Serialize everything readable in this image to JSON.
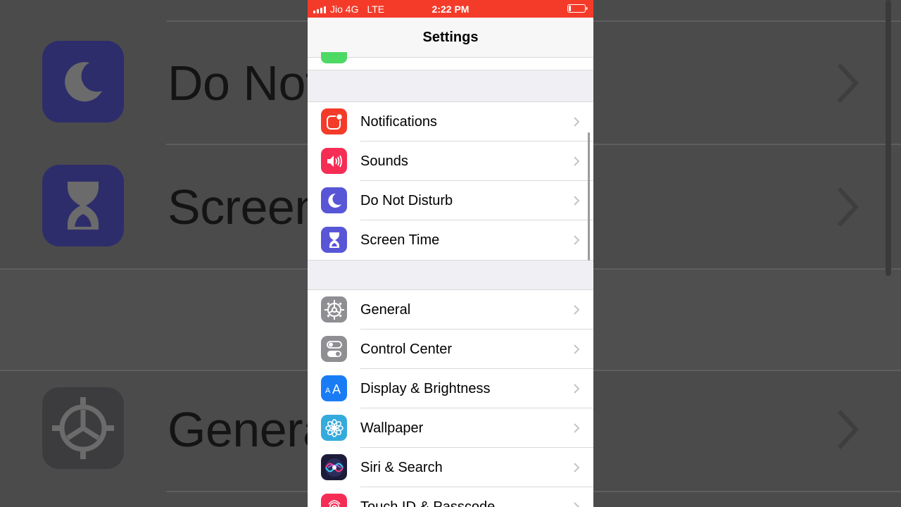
{
  "status_bar": {
    "carrier": "Jio 4G",
    "network": "LTE",
    "time": "2:22 PM",
    "background_color": "#f43b2a"
  },
  "nav": {
    "title": "Settings"
  },
  "groups": [
    {
      "items": [
        {
          "label": "Notifications",
          "icon": "notifications-icon",
          "color": "#f43b2a"
        },
        {
          "label": "Sounds",
          "icon": "speaker-icon",
          "color": "#f52d55"
        },
        {
          "label": "Do Not Disturb",
          "icon": "moon-icon",
          "color": "#5856d6"
        },
        {
          "label": "Screen Time",
          "icon": "hourglass-icon",
          "color": "#5856d6"
        }
      ]
    },
    {
      "items": [
        {
          "label": "General",
          "icon": "gear-icon",
          "color": "#8e8e93"
        },
        {
          "label": "Control Center",
          "icon": "toggles-icon",
          "color": "#8e8e93"
        },
        {
          "label": "Display & Brightness",
          "icon": "text-size-icon",
          "color": "#1a7cf5"
        },
        {
          "label": "Wallpaper",
          "icon": "flower-icon",
          "color": "#35aadc"
        },
        {
          "label": "Siri & Search",
          "icon": "siri-icon",
          "color": "#1c1c3a"
        },
        {
          "label": "Touch ID & Passcode",
          "icon": "fingerprint-icon",
          "color": "#f52d55"
        }
      ]
    }
  ],
  "background_zoom": {
    "items": [
      {
        "label": "Do Not",
        "icon": "moon-icon",
        "color": "#2e2d6b"
      },
      {
        "label": "Screen",
        "icon": "hourglass-icon",
        "color": "#2e2d6b"
      },
      {
        "label": "Genera",
        "icon": "gear-icon",
        "color": "#3c3c3e"
      }
    ]
  }
}
